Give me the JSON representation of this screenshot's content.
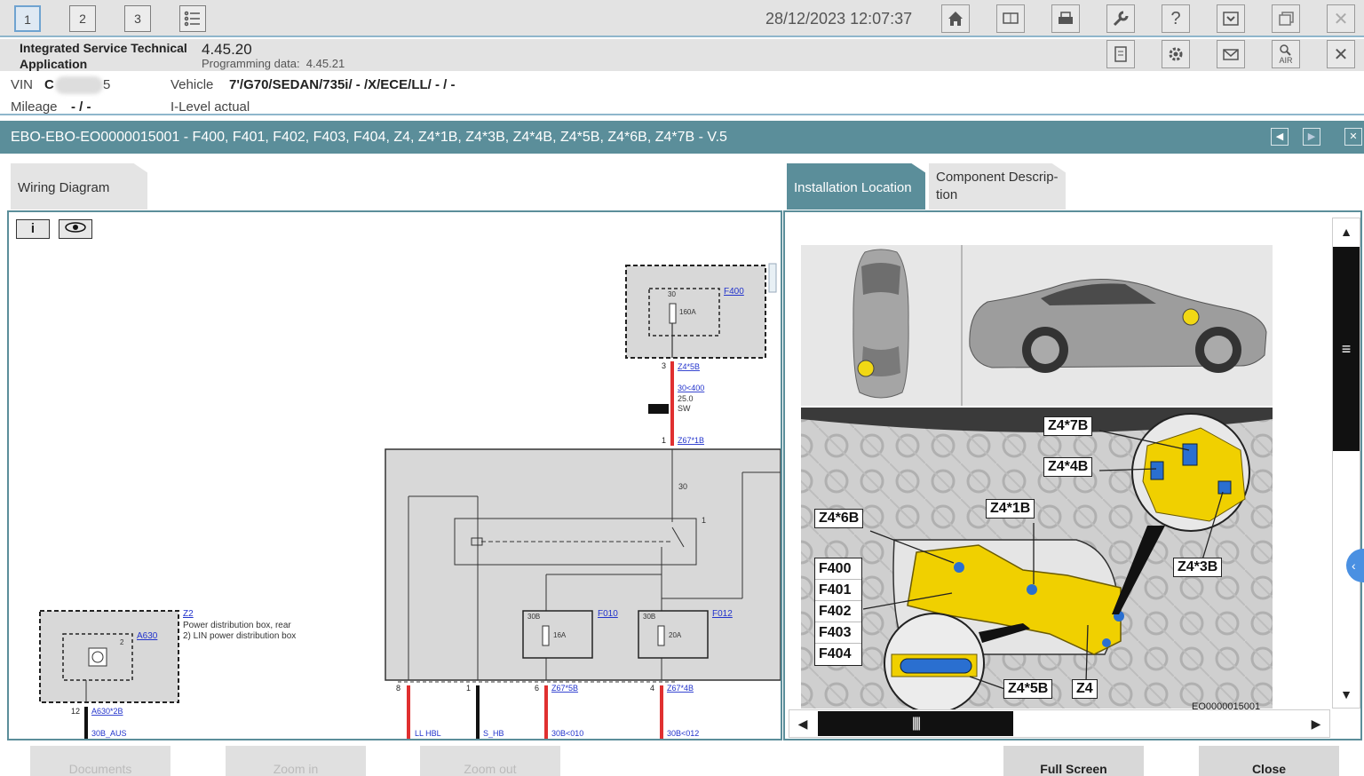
{
  "topbar": {
    "tabs": [
      "1",
      "2",
      "3"
    ],
    "datetime": "28/12/2023 12:07:37",
    "icons": [
      "list-icon",
      "home-icon",
      "display-icon",
      "printer-icon",
      "wrench-icon",
      "help-icon",
      "download-icon",
      "window-icon",
      "close-icon"
    ]
  },
  "app": {
    "name": "Integrated Service Technical Application",
    "version": "4.45.20",
    "programming_label": "Programming data:",
    "programming_value": "4.45.21",
    "air_label": "AIR"
  },
  "vehicle": {
    "vin_label": "VIN",
    "vin_value": "C",
    "vin_suffix": "5",
    "vehicle_label": "Vehicle",
    "vehicle_value": "7'/G70/SEDAN/735i/ - /X/ECE/LL/ - / -",
    "mileage_label": "Mileage",
    "mileage_value": "- / -",
    "ilevel_label": "I-Level actual"
  },
  "document": {
    "title": "EBO-EBO-EO0000015001 - F400, F401, F402, F403, F404, Z4, Z4*1B, Z4*3B, Z4*4B, Z4*5B, Z4*6B, Z4*7B - V.5"
  },
  "tabs": {
    "wiring": "Wiring Diagram",
    "install": "Installation Location",
    "component_l1": "Component Descrip-",
    "component_l2": "tion"
  },
  "left_toolbar": {
    "info": "i"
  },
  "wiring": {
    "f400": "F400",
    "f400_pin": "30",
    "f400_rating": "160A",
    "pin3": "3",
    "z45b": "Z4*5B",
    "wire1": "30<400",
    "wire2": "25.0",
    "wire3": "SW",
    "pin1": "1",
    "z671b": "Z67*1B",
    "p30": "30",
    "p1": "1",
    "f010": "F010",
    "f010_pin": "30B",
    "f010_rating": "16A",
    "f012": "F012",
    "f012_pin": "30B",
    "f012_rating": "20A",
    "bottom_pins": [
      "8",
      "1",
      "6",
      "4"
    ],
    "z675b": "Z67*5B",
    "z674b": "Z67*4B",
    "bot_labels": [
      "LL HBL",
      "S_HB",
      "30B<010",
      "30B<012"
    ],
    "z2": "Z2",
    "z2_desc1": "Power distribution box, rear",
    "z2_desc2": "2)    LIN power distribution box",
    "a630": "A630",
    "a630_pin": "2",
    "pin12": "12",
    "a6302b": "A630*2B",
    "a630_wire": "30B_AUS"
  },
  "install": {
    "callouts": {
      "z47b": "Z4*7B",
      "z44b": "Z4*4B",
      "z41b": "Z4*1B",
      "z46b": "Z4*6B",
      "z43b": "Z4*3B",
      "z45b": "Z4*5B",
      "z4": "Z4"
    },
    "fuses": [
      "F400",
      "F401",
      "F402",
      "F403",
      "F404"
    ],
    "image_id": "EO0000015001"
  },
  "bottombar": {
    "documents": "Documents",
    "zoom_in": "Zoom in",
    "zoom_out": "Zoom out",
    "full_screen": "Full Screen",
    "close": "Close"
  }
}
